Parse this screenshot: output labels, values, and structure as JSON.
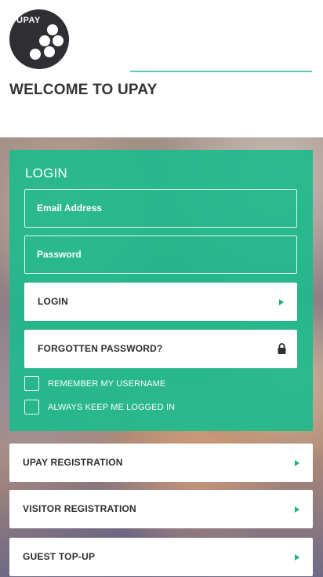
{
  "brand": {
    "logo_text": "UPAY",
    "accent_color": "#1fba8c",
    "logo_bg_color": "#2f2f33"
  },
  "header": {
    "welcome": "WELCOME TO UPAY"
  },
  "login": {
    "title": "LOGIN",
    "email_placeholder": "Email Address",
    "password_placeholder": "Password",
    "login_button": "LOGIN",
    "login_icon": "play-arrow-icon",
    "forgot_button": "FORGOTTEN PASSWORD?",
    "forgot_icon": "lock-icon",
    "remember_label": "REMEMBER MY USERNAME",
    "remember_checked": false,
    "keep_logged_label": "ALWAYS KEEP ME LOGGED IN",
    "keep_logged_checked": false
  },
  "nav": {
    "items": [
      {
        "label": "UPAY REGISTRATION",
        "icon": "play-arrow-icon"
      },
      {
        "label": "VISITOR REGISTRATION",
        "icon": "play-arrow-icon"
      },
      {
        "label": "GUEST TOP-UP",
        "icon": "play-arrow-icon"
      }
    ]
  }
}
